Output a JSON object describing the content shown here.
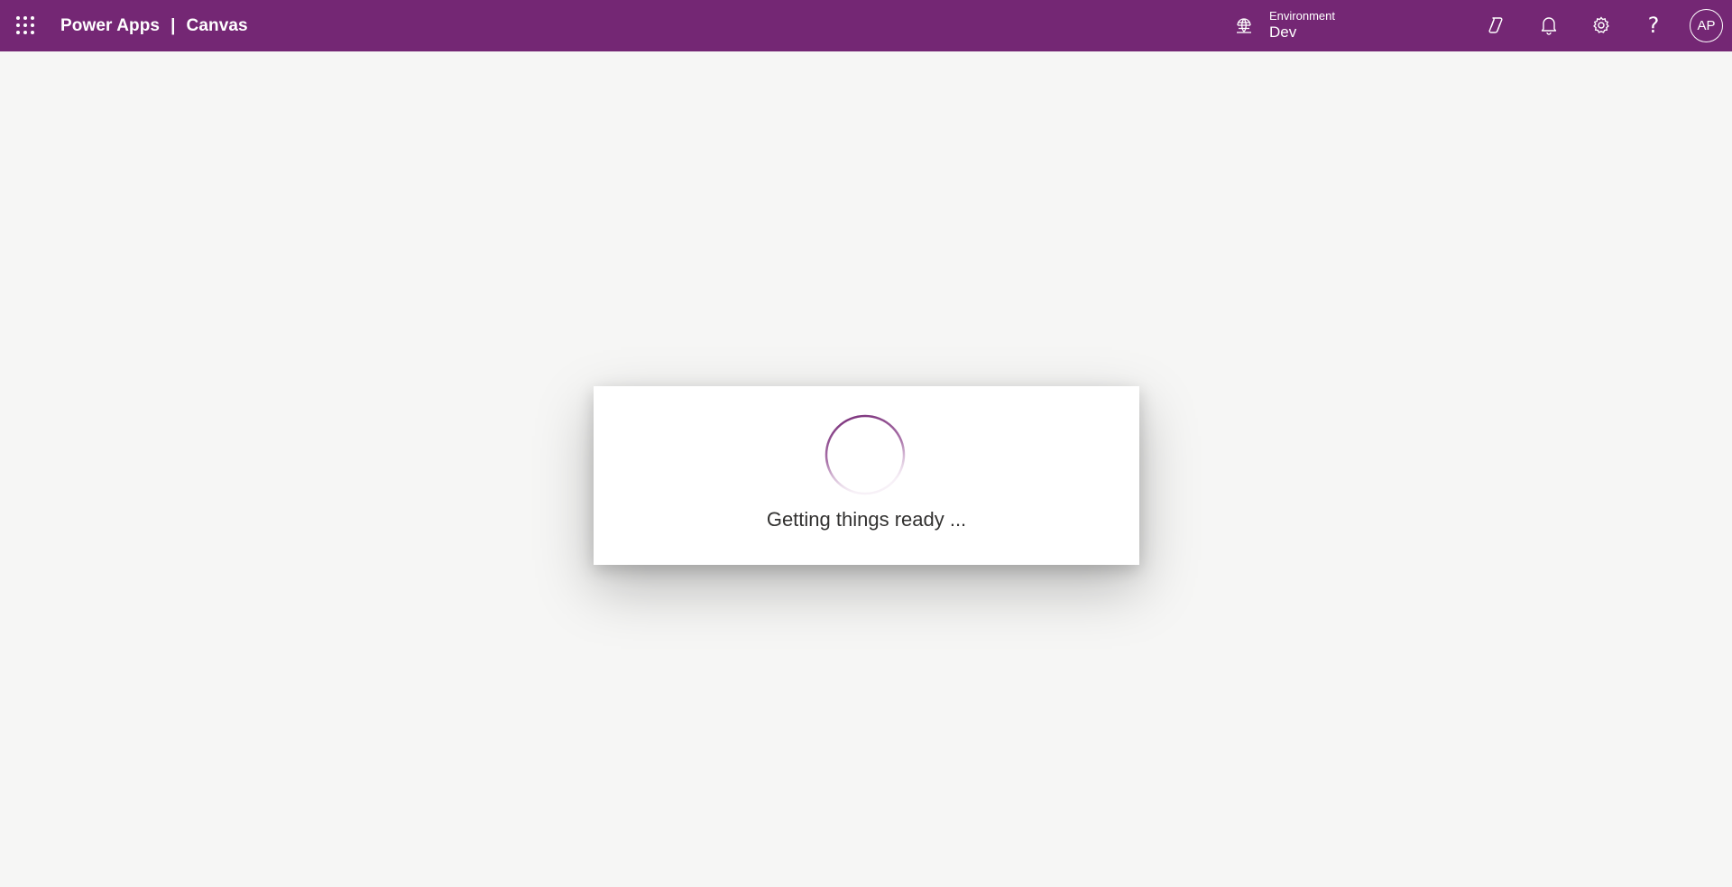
{
  "header": {
    "app_name": "Power Apps",
    "separator": "|",
    "section": "Canvas",
    "environment_label": "Environment",
    "environment_value": "Dev",
    "avatar_initials": "AP",
    "help_glyph": "?",
    "icons": [
      "app-launcher-icon",
      "environment-globe-icon",
      "copilot-icon",
      "bell-icon",
      "gear-icon",
      "help-icon"
    ],
    "brand_color": "#742774"
  },
  "dialog": {
    "loading_text": "Getting things ready ..."
  },
  "colors": {
    "background": "#f6f6f5",
    "spinner": "#742774"
  }
}
